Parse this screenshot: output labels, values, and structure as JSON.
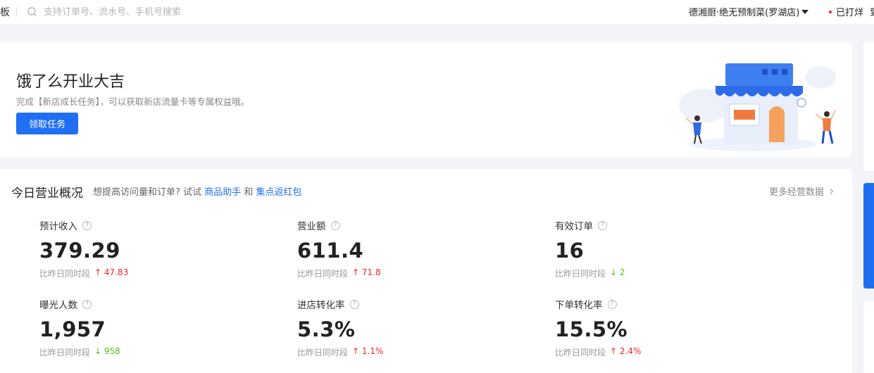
{
  "topbar": {
    "left_fragment": "板",
    "search_placeholder": "支持订单号、流水号、手机号搜索",
    "store_name": "德湘厨·绝无预制菜(罗湖店)",
    "print_status": "已打烊",
    "cut_fragment": "到"
  },
  "banner": {
    "title": "饿了么开业大吉",
    "description": "完成【新店成长任务】，可以获取新店流量卡等专属权益哦。",
    "button_label": "领取任务"
  },
  "overview": {
    "title": "今日营业概况",
    "hint_prefix": "想提高访问量和订单? 试试",
    "hint_link1": "商品助手",
    "hint_and": "和",
    "hint_link2": "集点返红包",
    "more_label": "更多经营数据",
    "metrics": [
      {
        "label": "预计收入",
        "value": "379.29",
        "compare_label": "比昨日同时段",
        "arrow": "↑",
        "delta": "47.83",
        "trend": "up"
      },
      {
        "label": "营业额",
        "value": "611.4",
        "compare_label": "比昨日同时段",
        "arrow": "↑",
        "delta": "71.8",
        "trend": "up"
      },
      {
        "label": "有效订单",
        "value": "16",
        "compare_label": "比昨日同时段",
        "arrow": "↓",
        "delta": "2",
        "trend": "down"
      },
      {
        "label": "曝光人数",
        "value": "1,957",
        "compare_label": "比昨日同时段",
        "arrow": "↓",
        "delta": "958",
        "trend": "down"
      },
      {
        "label": "进店转化率",
        "value": "5.3%",
        "compare_label": "比昨日同时段",
        "arrow": "↑",
        "delta": "1.1%",
        "trend": "up"
      },
      {
        "label": "下单转化率",
        "value": "15.5%",
        "compare_label": "比昨日同时段",
        "arrow": "↑",
        "delta": "2.4%",
        "trend": "up"
      }
    ]
  },
  "colors": {
    "accent": "#1f6ff3",
    "up": "#f5222d",
    "down": "#52c41a"
  },
  "icons": {
    "search": "search-icon",
    "help": "question-circle-icon",
    "caret": "caret-down-icon",
    "chevron": "chevron-right-icon"
  }
}
